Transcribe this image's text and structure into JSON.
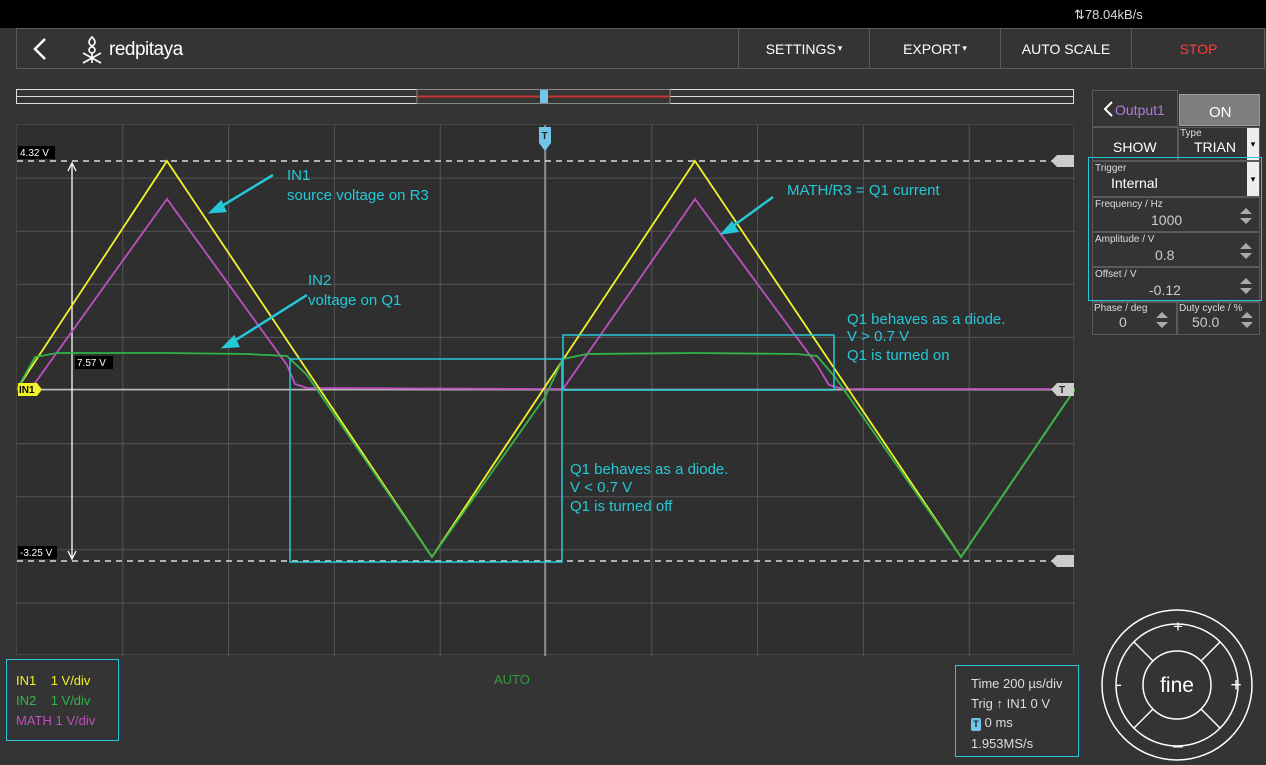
{
  "status": {
    "rate": "78.04kB/s"
  },
  "header": {
    "brand": "redpitaya",
    "settings": "SETTINGS",
    "export": "EXPORT",
    "autoscale": "AUTO SCALE",
    "stop": "STOP",
    "stop_color": "#ff3b3b"
  },
  "plot": {
    "upper_cursor": "4.32 V",
    "lower_cursor": "-3.25 V",
    "delta_label": "7.57 V",
    "channel_marker": "IN1",
    "trigger_marker": "T",
    "mode": "AUTO",
    "annotations": {
      "in1_title": "IN1",
      "in1_desc": "source voltage on R3",
      "in2_title": "IN2",
      "in2_desc": "voltage on Q1",
      "math_desc": "MATH/R3 = Q1 current",
      "diode_on_1": "Q1 behaves as a diode.",
      "diode_on_2": "V > 0.7 V",
      "diode_on_3": "Q1 is turned on",
      "diode_off_1": "Q1 behaves as a diode.",
      "diode_off_2": "V < 0.7 V",
      "diode_off_3": "Q1 is turned off"
    },
    "colors": {
      "in1": "#f2f22a",
      "in2": "#34b34a",
      "math": "#c050c0",
      "annot": "#25c8d8"
    }
  },
  "legend": {
    "rows": [
      {
        "name": "IN1",
        "scale": "1 V/div"
      },
      {
        "name": "IN2",
        "scale": "1 V/div"
      },
      {
        "name": "MATH",
        "scale": "1 V/div"
      }
    ]
  },
  "timebox": {
    "time": "Time 200 µs/div",
    "trig_prefix": "Trig",
    "trig_rest": "IN1 0 V",
    "delay": "0 ms",
    "rate": "1.953MS/s"
  },
  "output": {
    "title": "Output1",
    "on": "ON",
    "show": "SHOW",
    "type_label": "Type",
    "type_value": "TRIAN",
    "trigger_label": "Trigger",
    "trigger_value": "Internal",
    "freq_label": "Frequency / Hz",
    "freq_value": "1000",
    "amp_label": "Amplitude / V",
    "amp_value": "0.8",
    "offset_label": "Offset / V",
    "offset_value": "-0.12",
    "phase_label": "Phase / deg",
    "phase_value": "0",
    "duty_label": "Duty cycle / %",
    "duty_value": "50.0"
  },
  "control": {
    "center": "fine",
    "plus": "+",
    "minus": "-",
    "up": "+",
    "down": "–"
  }
}
